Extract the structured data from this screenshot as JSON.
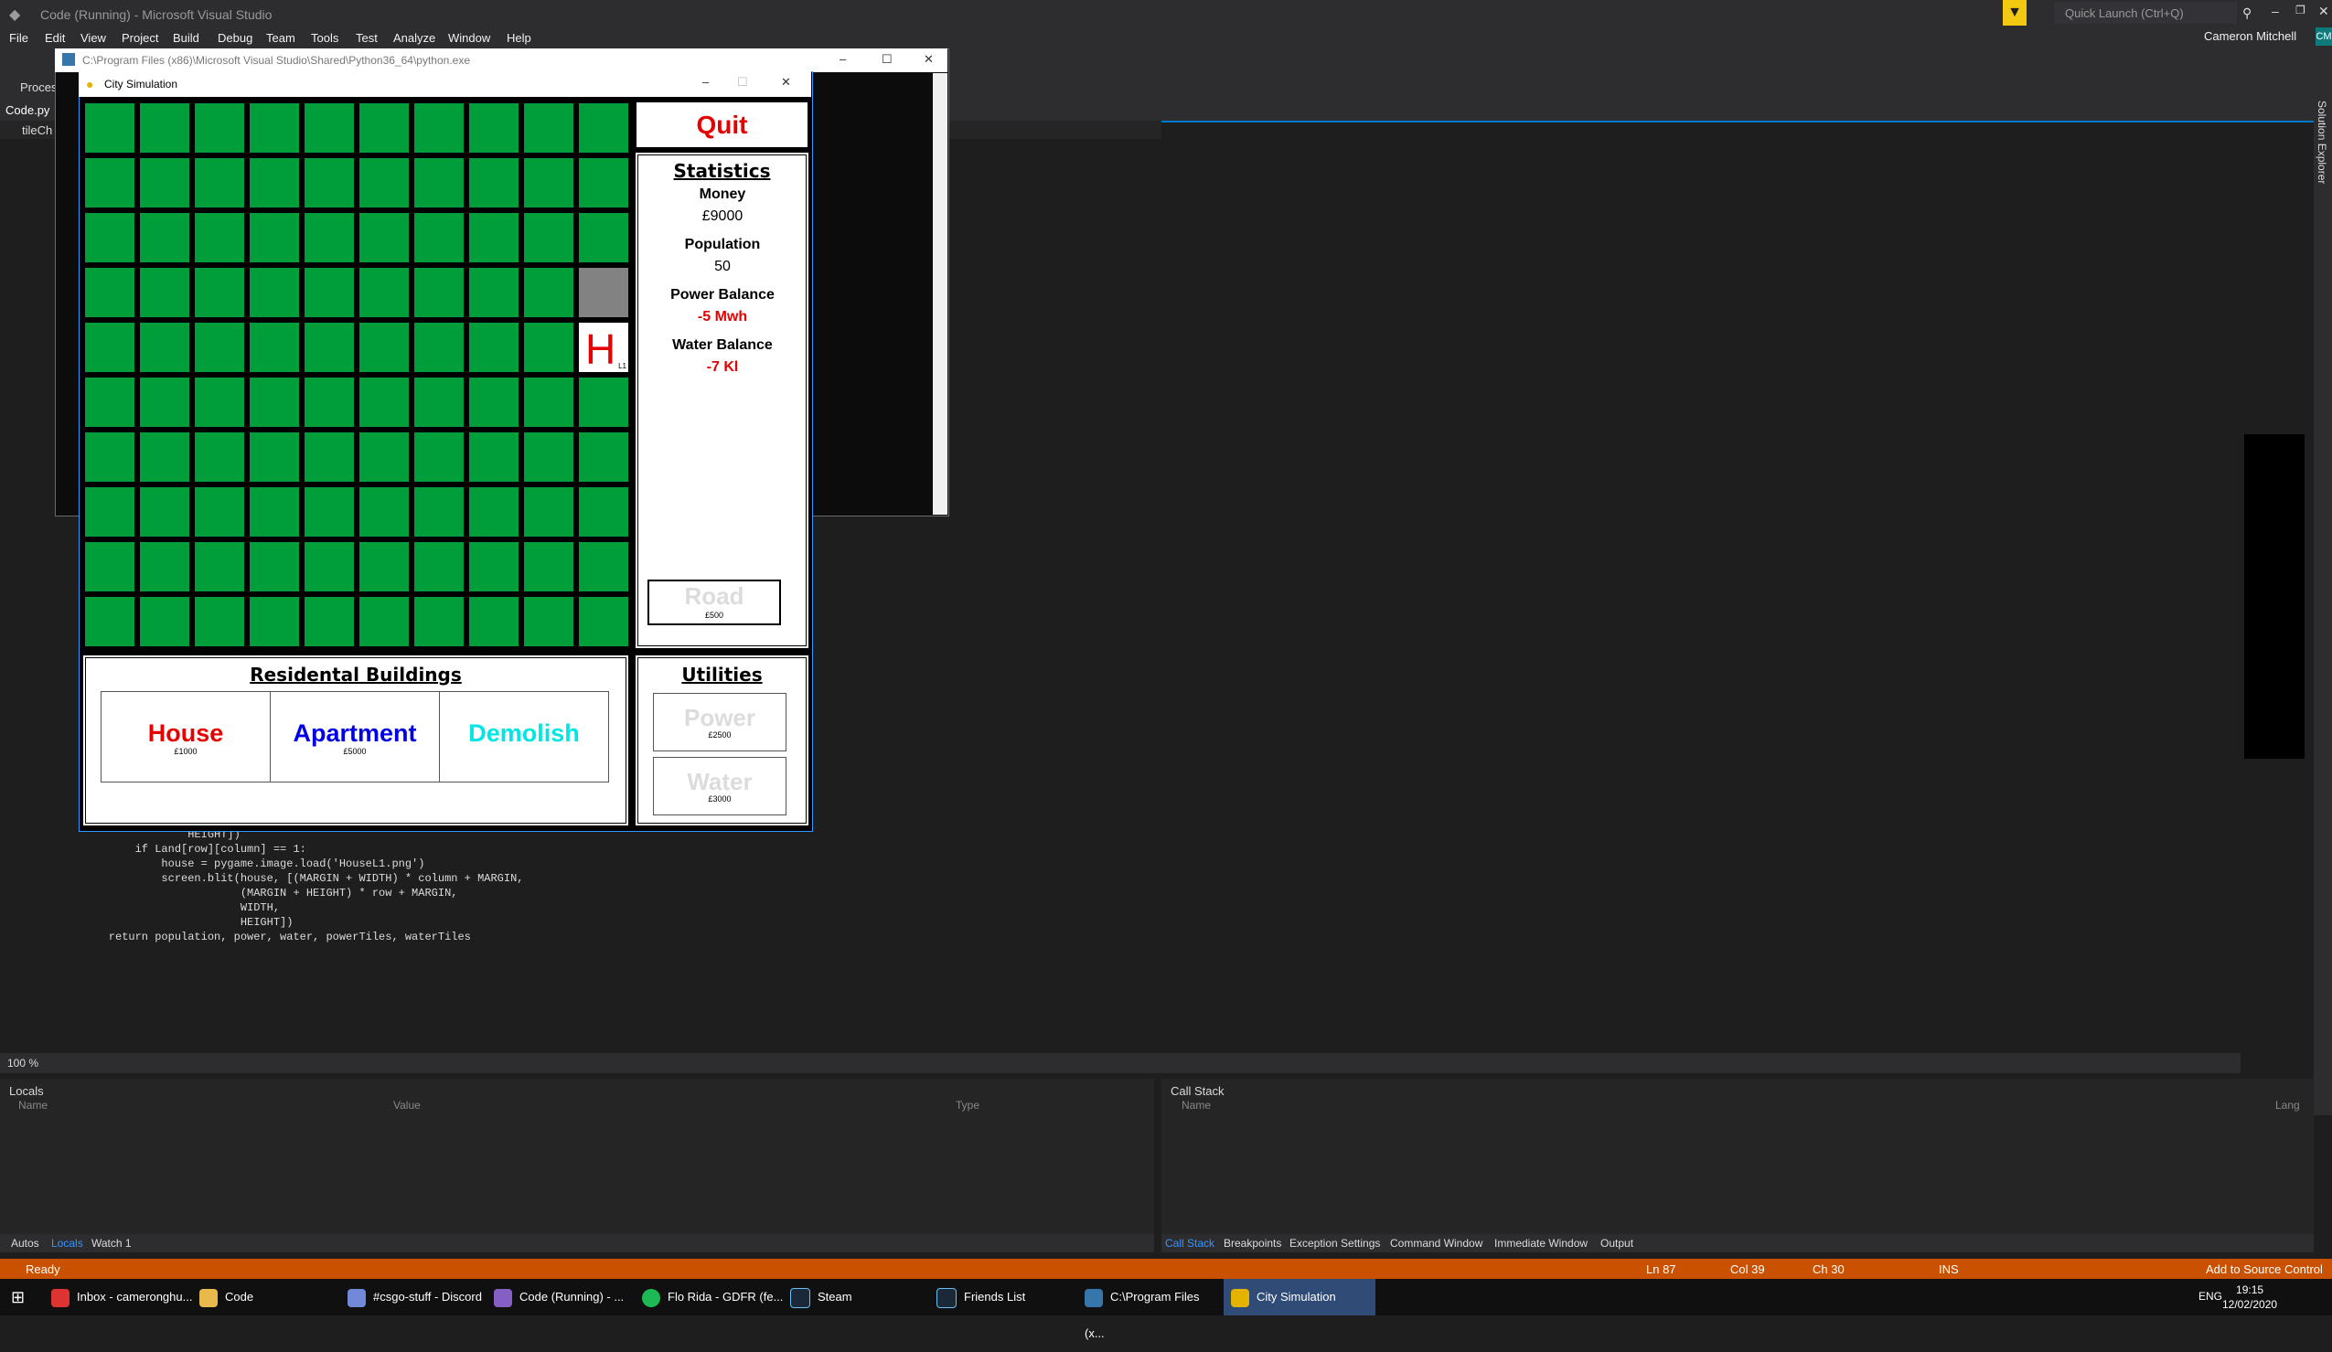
{
  "vs": {
    "title": "Code (Running) - Microsoft Visual Studio",
    "menu": [
      "File",
      "Edit",
      "View",
      "Project",
      "Build",
      "Debug",
      "Team",
      "Tools",
      "Test",
      "Analyze",
      "Window",
      "Help"
    ],
    "quick_launch": "Quick Launch (Ctrl+Q)",
    "user": "Cameron Mitchell",
    "user_initials": "CM",
    "process_label": "Process",
    "doc_tab": "Code.py",
    "nav_label": "tileCh",
    "solution_explorer": "Solution Explorer",
    "zoom": "100 %",
    "code_lines": [
      "                HEIGHT])",
      "        if Land[row][column] == 1:",
      "            house = pygame.image.load('HouseL1.png')",
      "            screen.blit(house, [(MARGIN + WIDTH) * column + MARGIN,",
      "                        (MARGIN + HEIGHT) * row + MARGIN,",
      "                        WIDTH,",
      "                        HEIGHT])",
      "    return population, power, water, powerTiles, waterTiles"
    ],
    "locals": {
      "title": "Locals",
      "cols": [
        "Name",
        "Value",
        "Type"
      ],
      "tabs": [
        "Autos",
        "Locals",
        "Watch 1"
      ],
      "active_tab": "Locals"
    },
    "callstack": {
      "title": "Call Stack",
      "cols": [
        "Name",
        "Lang"
      ],
      "tabs": [
        "Call Stack",
        "Breakpoints",
        "Exception Settings",
        "Command Window",
        "Immediate Window",
        "Output"
      ],
      "active_tab": "Call Stack"
    },
    "status": {
      "left": "Ready",
      "ln": "Ln 87",
      "col": "Col 39",
      "ch": "Ch 30",
      "ins": "INS",
      "right": "Add to Source Control"
    }
  },
  "console": {
    "title": "C:\\Program Files (x86)\\Microsoft Visual Studio\\Shared\\Python36_64\\python.exe"
  },
  "game": {
    "title": "City Simulation",
    "quit": "Quit",
    "stats": {
      "heading": "Statistics",
      "money_label": "Money",
      "money": "£9000",
      "population_label": "Population",
      "population": "50",
      "power_label": "Power Balance",
      "power": "-5 Mwh",
      "water_label": "Water Balance",
      "water": "-7 Kl"
    },
    "road": {
      "label": "Road",
      "price": "£500"
    },
    "residential": {
      "heading": "Residental Buildings",
      "house": {
        "label": "House",
        "price": "£1000"
      },
      "apartment": {
        "label": "Apartment",
        "price": "£5000"
      },
      "demolish": {
        "label": "Demolish"
      }
    },
    "utilities": {
      "heading": "Utilities",
      "power": {
        "label": "Power",
        "price": "£2500"
      },
      "water": {
        "label": "Water",
        "price": "£3000"
      }
    },
    "house_tile": {
      "letter": "H",
      "level": "L1"
    },
    "tiles": {
      "rows": 10,
      "cols": 10,
      "road": [
        3,
        9
      ],
      "house": [
        4,
        9
      ]
    },
    "colors": {
      "grass": "#009e3a",
      "road": "#828282",
      "red": "#e60000",
      "blue": "#0000e6",
      "cyan": "#00e6e6"
    }
  },
  "taskbar": {
    "items": [
      "Inbox - cameronghu...",
      "Code",
      "#csgo-stuff - Discord",
      "Code (Running) - ...",
      "Flo Rida - GDFR (fe...",
      "Steam",
      "Friends List",
      "C:\\Program Files (x...",
      "City Simulation"
    ],
    "lang": "ENG",
    "time": "19:15",
    "date": "12/02/2020"
  }
}
